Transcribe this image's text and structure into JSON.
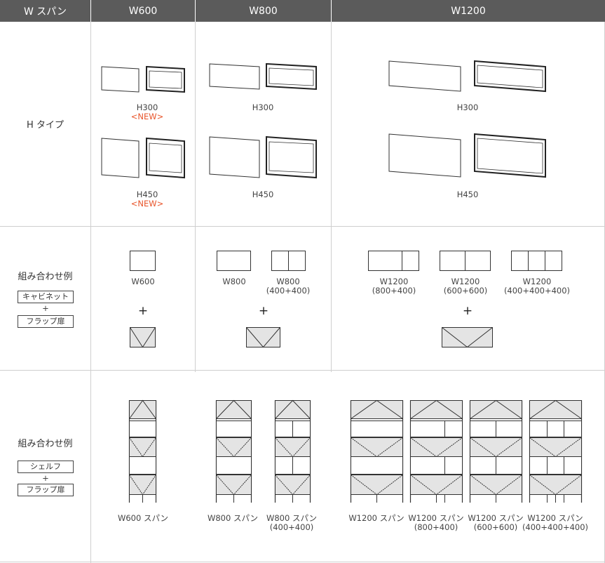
{
  "header": {
    "col0": "W スパン",
    "col1": "W600",
    "col2": "W800",
    "col3": "W1200"
  },
  "rows": {
    "htype_label": "H タイプ",
    "combo_label": "組み合わせ例",
    "combo1_box1": "キャビネット",
    "combo1_plus": "+",
    "combo1_box2": "フラップ扉",
    "combo2_box1": "シェルフ",
    "combo2_plus": "+",
    "combo2_box2": "フラップ扉"
  },
  "htype": {
    "w600_h300": "H300",
    "w600_h300_new": "<NEW>",
    "w600_h450": "H450",
    "w600_h450_new": "<NEW>",
    "w800_h300": "H300",
    "w800_h450": "H450",
    "w1200_h300": "H300",
    "w1200_h450": "H450"
  },
  "cabinet": {
    "w600": "W600",
    "w800a": "W800",
    "w800b": "W800",
    "w800b_sub": "(400+400)",
    "w1200a": "W1200",
    "w1200a_sub": "(800+400)",
    "w1200b": "W1200",
    "w1200b_sub": "(600+600)",
    "w1200c": "W1200",
    "w1200c_sub": "(400+400+400)",
    "plus": "+"
  },
  "shelf": {
    "w600": "W600 スパン",
    "w800a": "W800 スパン",
    "w800b": "W800 スパン",
    "w800b_sub": "(400+400)",
    "w1200a": "W1200 スパン",
    "w1200b": "W1200 スパン",
    "w1200b_sub": "(800+400)",
    "w1200c": "W1200 スパン",
    "w1200c_sub": "(600+600)",
    "w1200d": "W1200 スパン",
    "w1200d_sub": "(400+400+400)"
  }
}
